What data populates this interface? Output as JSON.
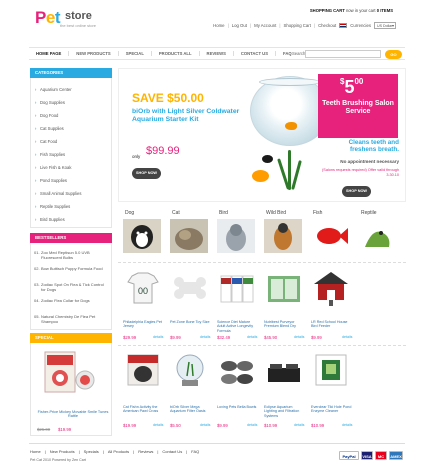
{
  "header": {
    "logo_pet_p": "P",
    "logo_pet_e": "e",
    "logo_pet_t": "t",
    "logo_store": "store",
    "tagline": "the best online store",
    "cart_prefix": "SHOPPING CART",
    "cart_suffix": "now in your cart",
    "cart_count": "0 ITEMS",
    "links": [
      "Home",
      "Log Out",
      "My Account",
      "Shopping Cart",
      "Checkout"
    ],
    "currencies_label": "Currencies",
    "currency_value": "US Dollar"
  },
  "nav": {
    "items": [
      "HOME PAGE",
      "NEW PRODUCTS",
      "SPECIAL",
      "PRODUCTS ALL",
      "REVIEWS",
      "CONTACT US",
      "FAQ"
    ],
    "search_label": "Search",
    "go_label": "GO"
  },
  "sidebar": {
    "categories_title": "CATEGORIES",
    "categories": [
      "Aquarium Center",
      "Dog Supplies",
      "Dog Food",
      "Cat Supplies",
      "Cat Food",
      "Fish Supplies",
      "Live Fish & Koak",
      "Pond Supplies",
      "Small Animal Supplies",
      "Reptile Supplies",
      "Bird Supplies"
    ],
    "best_title": "BESTSELLERS",
    "best": [
      {
        "num": "01.",
        "text": "Zoo Med Reptisun 5.0 UVB Fluorescent Bulbs"
      },
      {
        "num": "02.",
        "text": "Bow Buttisch Puppy Formula Food"
      },
      {
        "num": "03.",
        "text": "Zodiac Spot On Flea & Tick Control for Dogs"
      },
      {
        "num": "04.",
        "text": "Zodiac Flea Collar for Dogs"
      },
      {
        "num": "05.",
        "text": "Natural Chemistry De Flea Pet Shampoo"
      }
    ],
    "special_title": "SPECIAL",
    "special_name": "Fisher-Price Mickey Movable Smile Tunes Rattle",
    "special_old": "$26.00",
    "special_new": "$19.99"
  },
  "banner": {
    "save": "SAVE $50.00",
    "desc": "biOrb with Light Silver Coldwater Aquarium Starter Kit",
    "only_label": "only",
    "price": "$99.99",
    "shop1": "SHOP NOW",
    "big_price_dollar": "$",
    "big_price_int": "5",
    "big_price_cents": "00",
    "promo": "Teeth Brushing Salon Service",
    "clean": "Cleans teeth and freshens breath.",
    "appt": "No appointment necessary",
    "res": "(Salons requests required) Offer valid through 3.30.10",
    "shop2": "SHOP NOW"
  },
  "pet_tabs": [
    "Dog",
    "Cat",
    "Bird",
    "Wild Bird",
    "Fish",
    "Reptile"
  ],
  "products_row1": [
    {
      "name": "Philadelphia Eagles Pet Jersey",
      "price": "$29.99",
      "details": "details"
    },
    {
      "name": "Pet Zone Bone Toy Size",
      "price": "$9.99",
      "details": "details"
    },
    {
      "name": "Science Diet Mature Adult Active Longevity Formula",
      "price": "$32.49",
      "details": "details"
    },
    {
      "name": "Nutribest Purveyor Premium Blend Dry",
      "price": "$45.90",
      "details": "details"
    },
    {
      "name": "LR Red School House Bird Feeder",
      "price": "$9.99",
      "details": "details"
    }
  ],
  "products_row2": [
    {
      "name": "Cat Fishn Activity the American Pawl Cross",
      "price": "$19.99",
      "details": "details"
    },
    {
      "name": "biOrb Silver Mega Aquarium Filter Oasis",
      "price": "$5.50",
      "details": "details"
    },
    {
      "name": "Loving Pets Bella Bowls",
      "price": "$9.99",
      "details": "details"
    },
    {
      "name": "Eclipse Aquarium Lighting and Filtration Systems",
      "price": "$10.99",
      "details": "details"
    },
    {
      "name": "Everclear Tiki Hole Pond Enzyme Cleaner",
      "price": "$10.99",
      "details": "details"
    }
  ],
  "footer": {
    "links": [
      "Home",
      "New Products",
      "Specials",
      "All Products",
      "Reviews",
      "Contact Us",
      "FAQ"
    ],
    "copyright": "Pet Cat 2010 Powered by Zen Cart"
  },
  "payments": [
    "PayPal",
    "VISA",
    "MC",
    "AMEX"
  ],
  "colors": {
    "pink": "#e6227d",
    "blue": "#29abe2",
    "yellow": "#ffb400"
  }
}
